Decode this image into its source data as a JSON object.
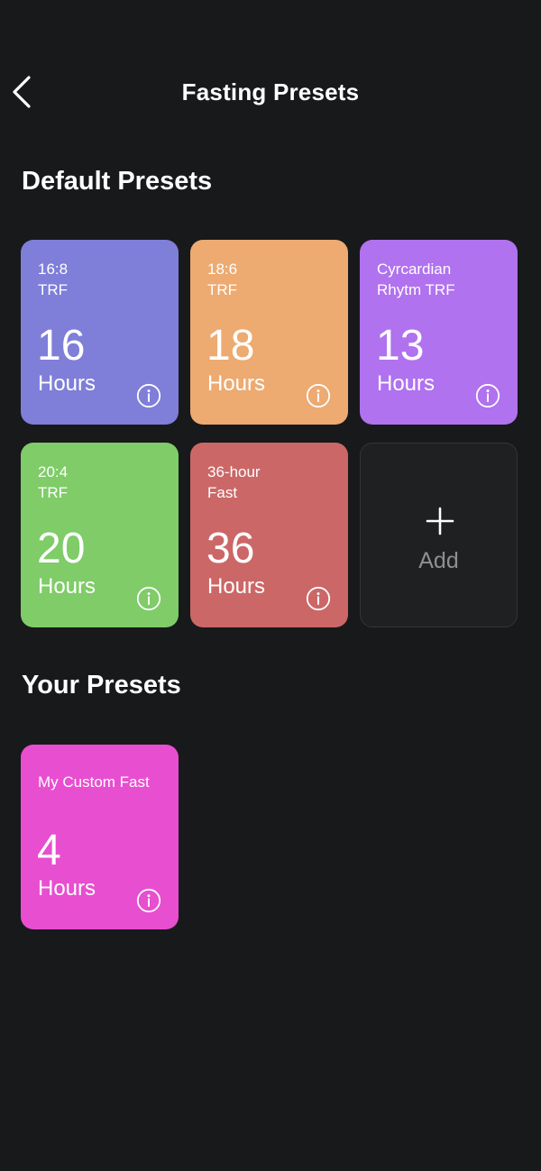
{
  "header": {
    "title": "Fasting Presets",
    "back_icon": "chevron-left-icon"
  },
  "default_section": {
    "title": "Default Presets",
    "presets": [
      {
        "name": "16:8\nTRF",
        "value": "16",
        "unit": "Hours",
        "color": "#7f7ed8"
      },
      {
        "name": "18:6\nTRF",
        "value": "18",
        "unit": "Hours",
        "color": "#edaa71"
      },
      {
        "name": "Cyrcardian\nRhytm TRF",
        "value": "13",
        "unit": "Hours",
        "color": "#b072ee"
      },
      {
        "name": "20:4\nTRF",
        "value": "20",
        "unit": "Hours",
        "color": "#7fcc68"
      },
      {
        "name": "36-hour\nFast",
        "value": "36",
        "unit": "Hours",
        "color": "#cc6767"
      }
    ],
    "add_label": "Add",
    "add_icon": "plus-icon"
  },
  "custom_section": {
    "title": "Your Presets",
    "presets": [
      {
        "name": "My Custom Fast",
        "value": "4",
        "unit": "Hours",
        "color": "#e84ed0"
      }
    ]
  },
  "info_icon": "info-icon"
}
